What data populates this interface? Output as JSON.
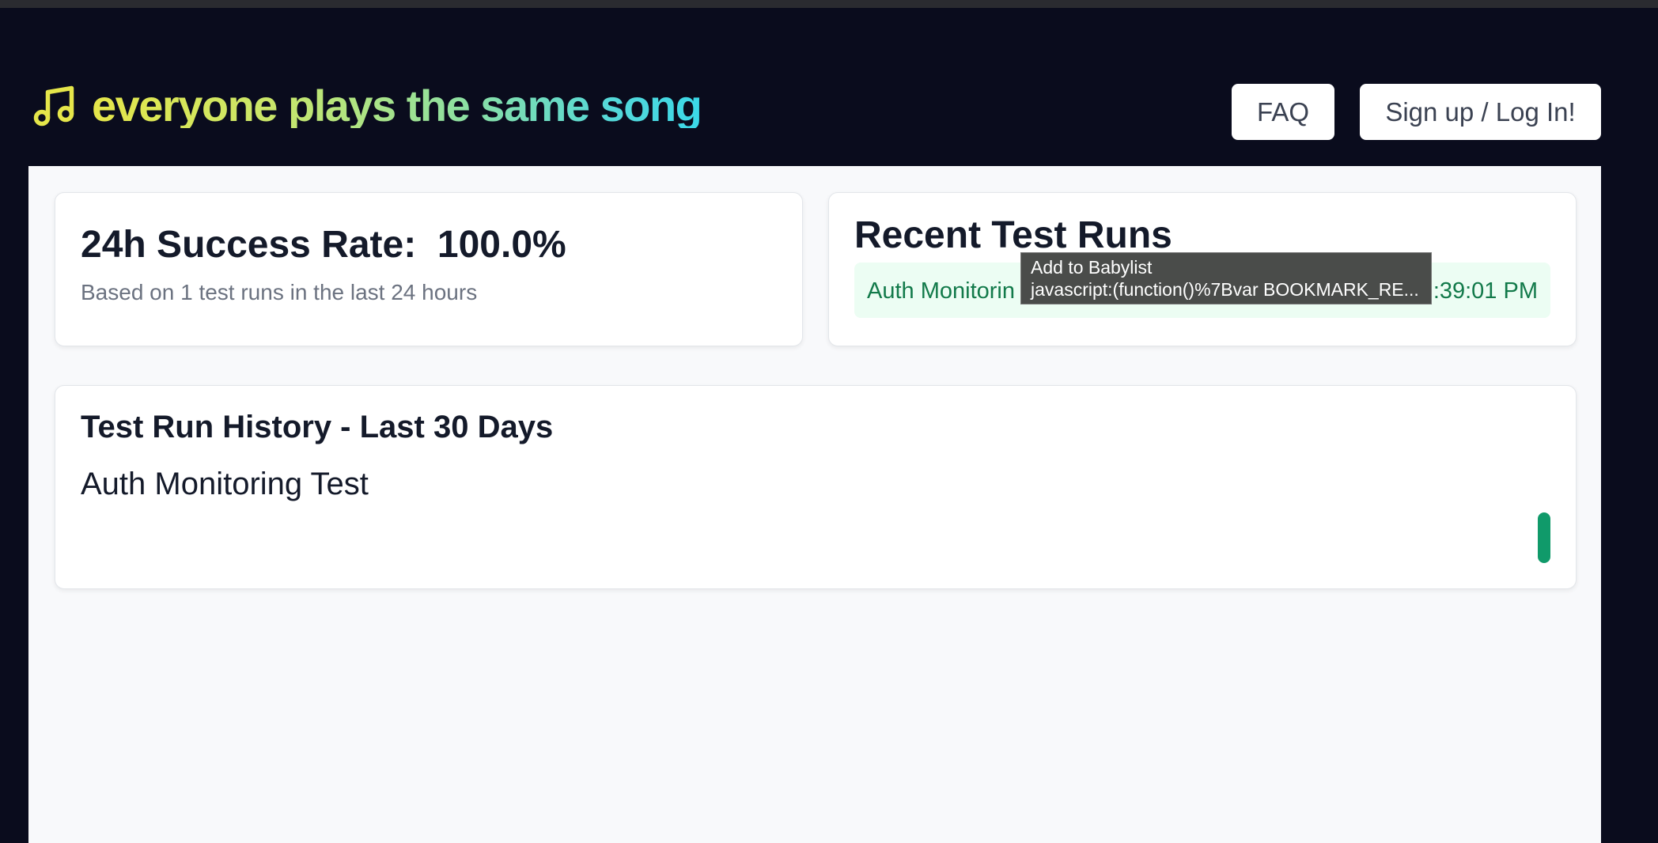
{
  "header": {
    "logo_icon": "music-notes-icon",
    "title": "everyone plays the same song",
    "faq_label": "FAQ",
    "login_label": "Sign up / Log In!"
  },
  "success_card": {
    "title": "24h Success Rate:  100.0%",
    "subtitle": "Based on 1 test runs in the last 24 hours"
  },
  "recent_card": {
    "title": "Recent Test Runs",
    "runs": [
      {
        "name": "Auth Monitorin",
        "time": ":39:01 PM",
        "status_color": "#127a4a"
      }
    ]
  },
  "history_card": {
    "title": "Test Run History - Last 30 Days",
    "test_name": "Auth Monitoring Test",
    "bar_color": "#109a6a"
  },
  "tooltip": {
    "line1": "Add to Babylist",
    "line2": "javascript:(function()%7Bvar BOOKMARK_RE..."
  }
}
